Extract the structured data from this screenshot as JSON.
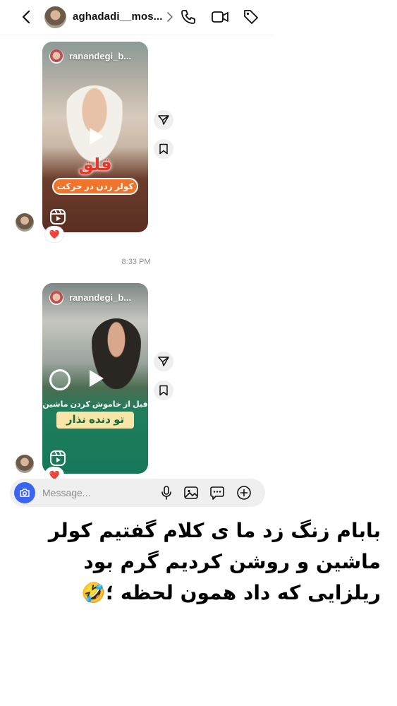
{
  "header": {
    "username": "aghadadi__mos...",
    "chevron": "›"
  },
  "messages": [
    {
      "reel_user": "ranandegi_b...",
      "overlay_title": "قلق",
      "overlay_subtitle": "کولر زدن در حرکت",
      "reaction": "❤️"
    },
    {
      "reel_user": "ranandegi_b...",
      "overlay_line1": "قبل از خاموش کردن ماشین",
      "overlay_line2": "تو دنده نذار",
      "reaction": "❤️"
    }
  ],
  "timestamp": "8:33 PM",
  "composer": {
    "placeholder": "Message..."
  },
  "caption": {
    "line1": "بابام زنگ زد ما ی کلام گفتیم کولر",
    "line2": "ماشین و روشن کردیم گرم بود",
    "line3": "ریلزایی که داد همون لحظه ؛🤣"
  },
  "colors": {
    "accent": "#3a65f4",
    "reaction": "#e0245e",
    "muted": "#8e8e8e"
  },
  "icons": [
    "back-icon",
    "chevron-right-icon",
    "phone-icon",
    "video-call-icon",
    "tag-icon",
    "play-icon",
    "reels-icon",
    "share-icon",
    "bookmark-icon",
    "camera-icon",
    "microphone-icon",
    "gallery-icon",
    "sticker-icon",
    "plus-icon"
  ]
}
